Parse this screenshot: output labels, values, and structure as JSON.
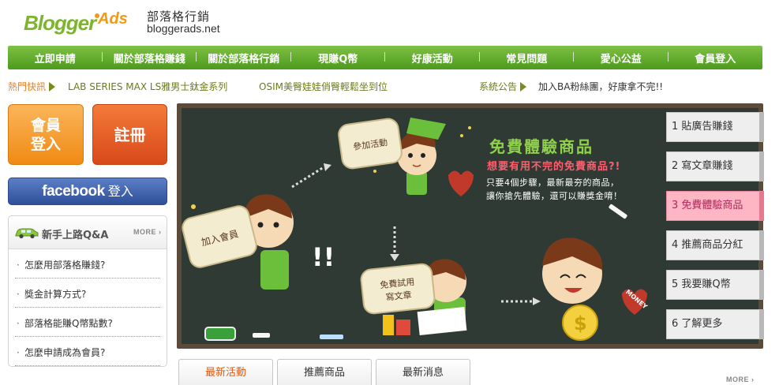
{
  "header": {
    "logo_text": "BloggerAds",
    "title_cn": "部落格行銷",
    "url": "bloggerads.net"
  },
  "nav": {
    "items": [
      "立即申請",
      "關於部落格賺錢",
      "關於部落格行銷",
      "現賺Q幣",
      "好康活動",
      "常見問題",
      "愛心公益",
      "會員登入"
    ]
  },
  "ticker": {
    "hot_label": "熱門快訊",
    "hot_items": [
      "LAB SERIES MAX LS雅男士鈦金系列",
      "OSIM美臀娃娃俏臀輕鬆坐到位"
    ],
    "system_label": "系統公告",
    "system_text": "加入BA粉絲團，好康拿不完!!"
  },
  "left": {
    "login_line1": "會員",
    "login_line2": "登入",
    "register": "註冊",
    "facebook_word": "facebook",
    "facebook_login": "登入",
    "faq": {
      "title": "新手上路Q&A",
      "more": "MORE",
      "items": [
        "怎麼用部落格賺錢?",
        "獎金計算方式?",
        "部落格能賺Q幣點數?",
        "怎麼申請成為會員?"
      ]
    }
  },
  "banner": {
    "title": "免費體驗商品",
    "subtitle": "想要有用不完的免費商品?!",
    "desc_line1": "只要4個步驟，最新最夯的商品，",
    "desc_line2": "讓你搶先體驗，還可以賺獎金唷！",
    "tags": {
      "join": "參加活動",
      "member": "加入會員",
      "trial_line1": "免費試用",
      "trial_line2": "寫文章",
      "money": "MONEY"
    },
    "side_tabs": [
      "1 貼廣告賺錢",
      "2 寫文章賺錢",
      "3 免費體驗商品",
      "4 推薦商品分紅",
      "5 我要賺Q幣",
      "6 了解更多"
    ],
    "active_tab_index": 2
  },
  "bottom_tabs": {
    "items": [
      "最新活動",
      "推薦商品",
      "最新消息"
    ],
    "active_index": 0,
    "more": "MORE"
  },
  "colors": {
    "nav_green": "#5ea92a",
    "login_orange": "#f08a14",
    "register_red": "#d8491a",
    "facebook_blue": "#3b5998",
    "board": "#2e3a33",
    "active_tab_pink": "#ffb6c4"
  }
}
